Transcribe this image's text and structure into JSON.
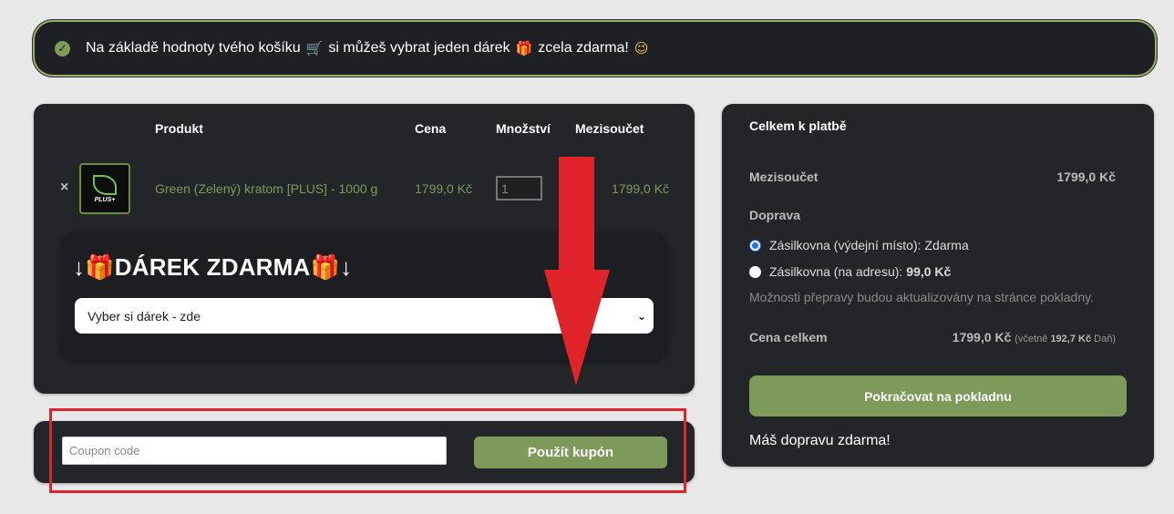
{
  "notice": {
    "text_before": "Na základě hodnoty tvého košíku",
    "text_middle": "si můžeš vybrat jeden dárek",
    "text_after": "zcela zdarma!",
    "icons": [
      "check-circle-icon",
      "cart-icon",
      "gift-icon",
      "wink-smile-icon"
    ]
  },
  "cart": {
    "headers": {
      "product": "Produkt",
      "price": "Cena",
      "quantity": "Množství",
      "subtotal": "Mezisoučet"
    },
    "items": [
      {
        "remove": "×",
        "thumb_text": "PLUS+",
        "name": "Green (Zelený) kratom [PLUS] - 1000 g",
        "price": "1799,0 Kč",
        "quantity": "1",
        "subtotal": "1799,0 Kč"
      }
    ],
    "gift": {
      "title": "DÁREK ZDARMA",
      "arrow_left": "↓",
      "arrow_right": "↓",
      "select_value": "Vyber si dárek - zde"
    }
  },
  "coupon": {
    "placeholder": "Coupon code",
    "button": "Použít kupón"
  },
  "summary": {
    "title": "Celkem k platbě",
    "subtotal_label": "Mezisoučet",
    "subtotal_value": "1799,0 Kč",
    "shipping_label": "Doprava",
    "shipping_options": [
      {
        "label": "Zásilkovna (výdejní místo): ",
        "price": "Zdarma",
        "selected": true
      },
      {
        "label": "Zásilkovna (na adresu): ",
        "price": "99,0 Kč",
        "selected": false
      }
    ],
    "shipping_note": "Možnosti přepravy budou aktualizovány na stránce pokladny.",
    "total_label": "Cena celkem",
    "total_value": "1799,0 Kč",
    "tax_prefix": "(včetně",
    "tax_value": "192,7 Kč",
    "tax_suffix": "Daň)",
    "checkout_button": "Pokračovat na pokladnu",
    "free_shipping": "Máš dopravu zdarma!"
  },
  "colors": {
    "accent_green": "#7d9a5b",
    "panel_bg": "#232528",
    "annotation_red": "#e0242a"
  }
}
